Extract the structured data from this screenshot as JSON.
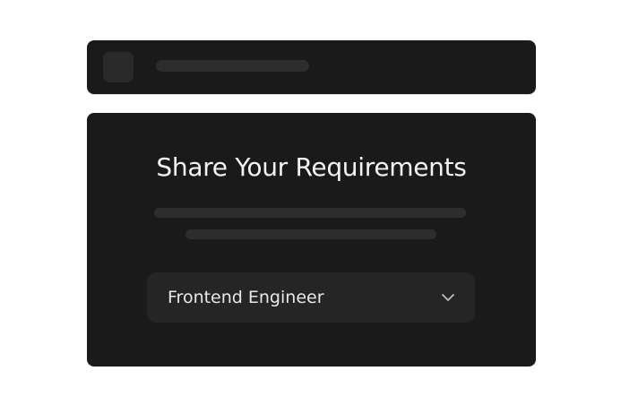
{
  "card": {
    "title": "Share Your Requirements"
  },
  "role_select": {
    "selected": "Frontend Engineer"
  },
  "colors": {
    "panel": "#1a1a1a",
    "placeholder": "#2d2d2d",
    "select_bg": "#252525",
    "title_text": "#f3f3f3"
  }
}
